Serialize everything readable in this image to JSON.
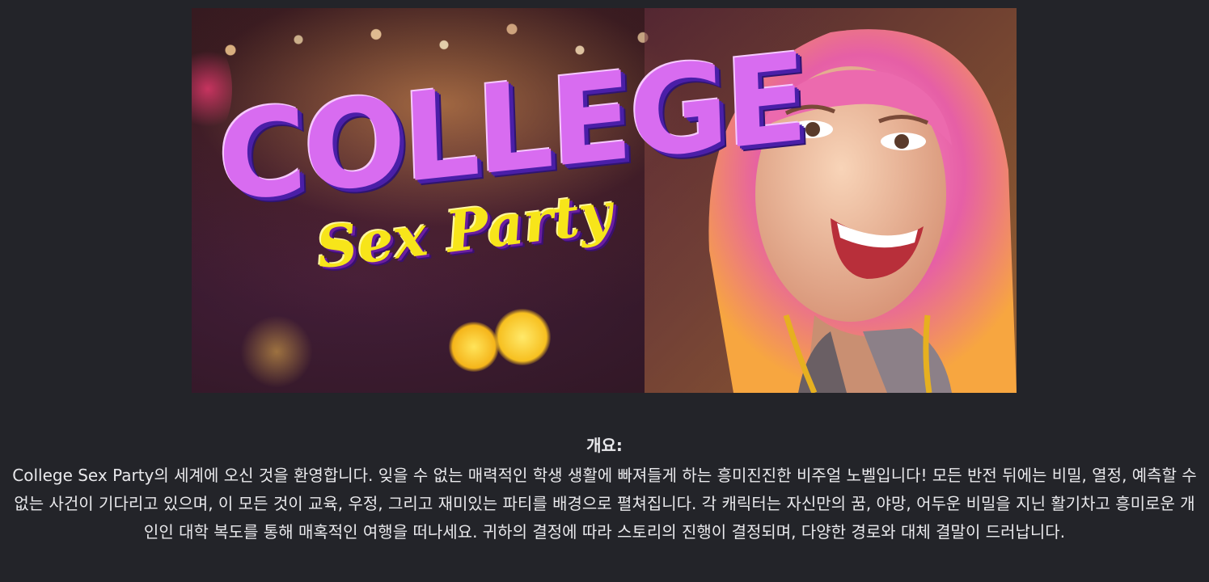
{
  "banner": {
    "title_main": "COLLEGE",
    "title_sub": "Sex Party"
  },
  "description": {
    "heading": "개요:",
    "body": "College Sex Party의 세계에 오신 것을 환영합니다. 잊을 수 없는 매력적인 학생 생활에 빠져들게 하는 흥미진진한 비주얼 노벨입니다! 모든 반전 뒤에는 비밀, 열정, 예측할 수 없는 사건이 기다리고 있으며, 이 모든 것이 교육, 우정, 그리고 재미있는 파티를 배경으로 펼쳐집니다. 각 캐릭터는 자신만의 꿈, 야망, 어두운 비밀을 지닌 활기차고 흥미로운 개인인 대학 복도를 통해 매혹적인 여행을 떠나세요. 귀하의 결정에 따라 스토리의 진행이 결정되며, 다양한 경로와 대체 결말이 드러납니다."
  },
  "colors": {
    "page_background": "#232429",
    "title_purple": "#d86cf0",
    "title_yellow": "#f7e51a",
    "hair_pink": "#f07ab8"
  }
}
